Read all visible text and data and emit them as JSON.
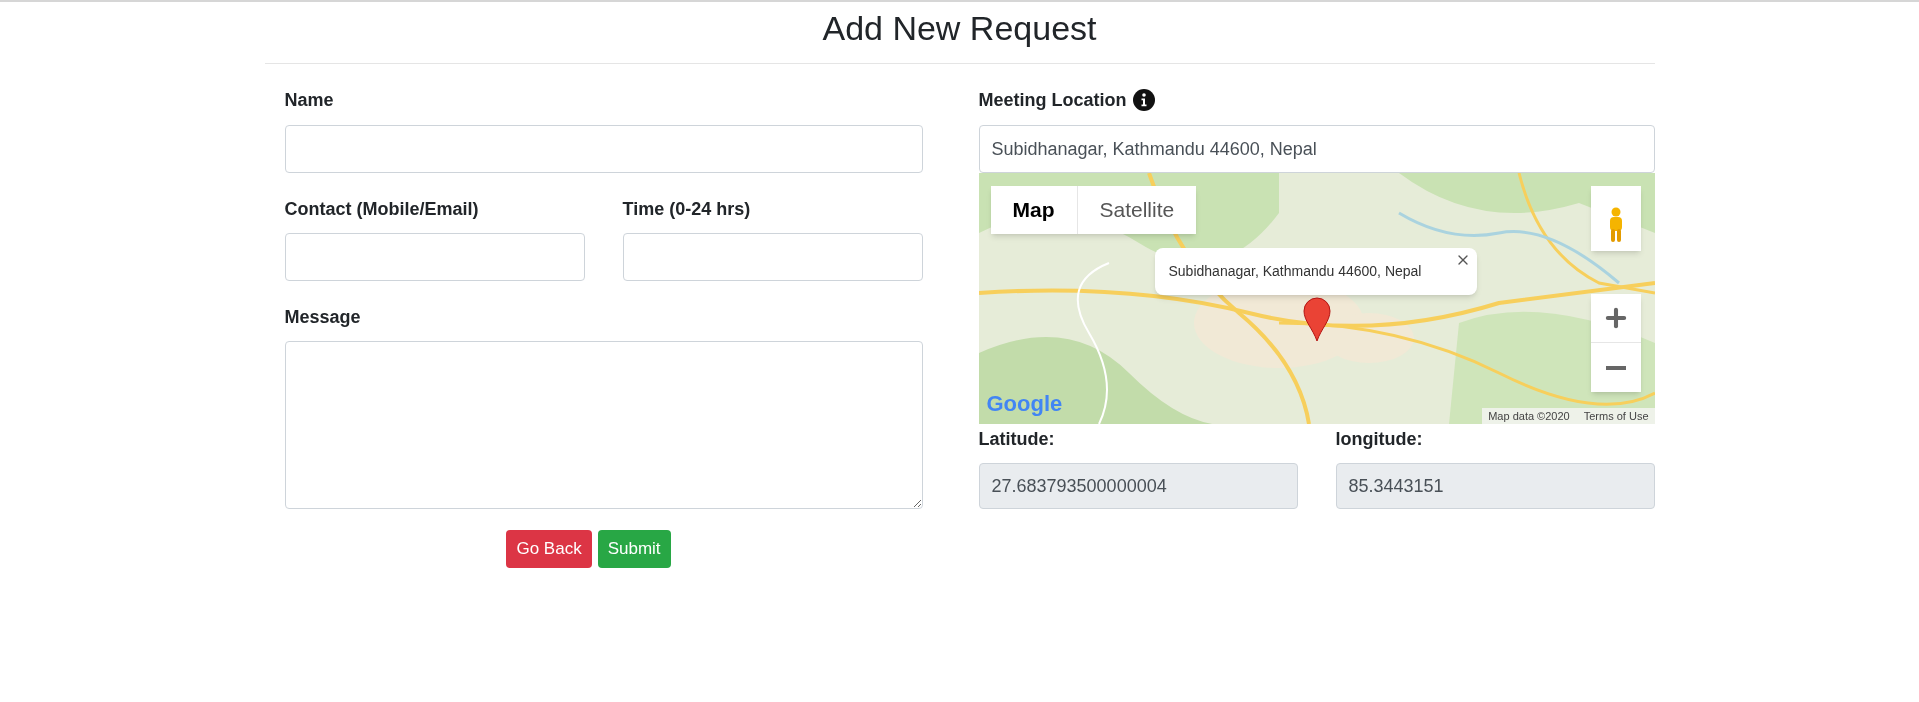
{
  "page": {
    "title": "Add New Request"
  },
  "left": {
    "name": {
      "label": "Name"
    },
    "contact": {
      "label": "Contact (Mobile/Email)"
    },
    "time": {
      "label": "Time (0-24 hrs)"
    },
    "message": {
      "label": "Message"
    },
    "buttons": [
      {
        "label": "Go Back",
        "kind": "danger"
      },
      {
        "label": "Submit",
        "kind": "success"
      }
    ]
  },
  "right": {
    "location": {
      "label": "Meeting Location",
      "value": "Subidhanagar, Kathmandu 44600, Nepal"
    },
    "map": {
      "map_types": [
        {
          "label": "Map",
          "selected": true
        },
        {
          "label": "Satellite",
          "selected": false
        }
      ],
      "info_window": "Subidhanagar, Kathmandu 44600, Nepal",
      "logo": "Google",
      "attribution": "Map data ©2020",
      "terms": "Terms of Use"
    },
    "latitude": {
      "label": "Latitude:",
      "value": "27.683793500000004"
    },
    "longitude": {
      "label": "longitude:",
      "value": "85.3443151"
    }
  }
}
